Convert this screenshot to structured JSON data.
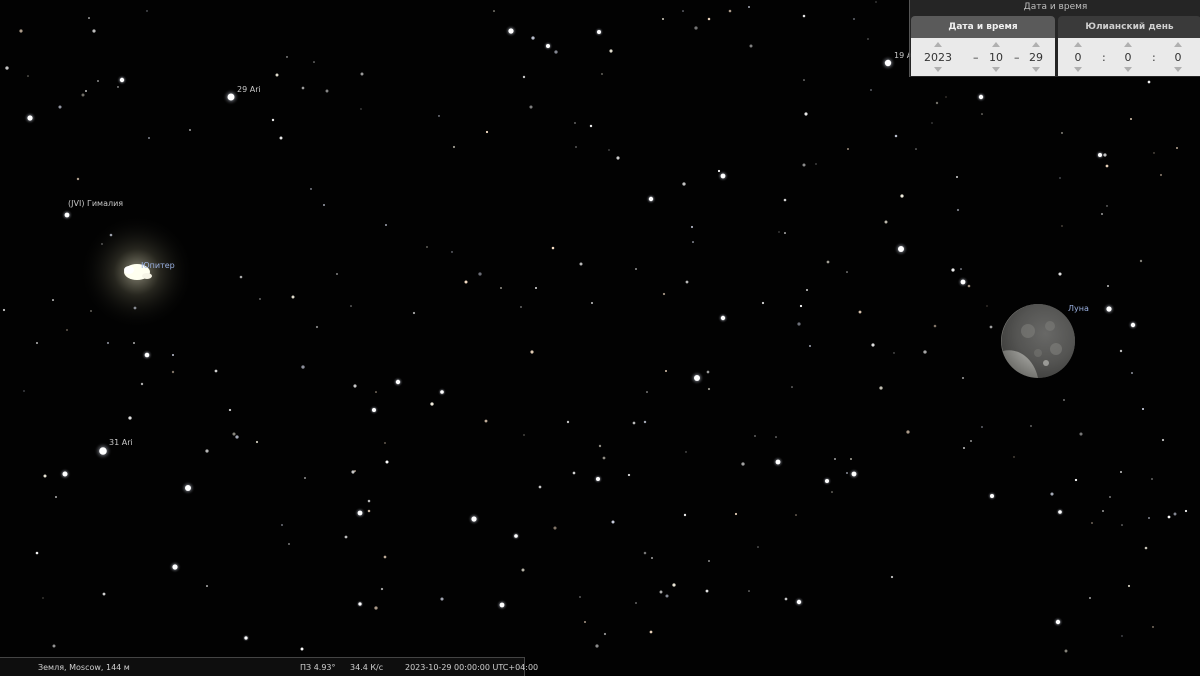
{
  "sky_labels": {
    "ari29": "29 Ari",
    "himalia": "(JVI) Гималия",
    "jupiter": "Юпитер",
    "ari31": "31 Ari",
    "ari19": "19 A",
    "moon": "Луна"
  },
  "datetime_window": {
    "title": "Дата и время",
    "date_tab": {
      "label": "Дата и время",
      "year": "2023",
      "month": "10",
      "day": "29",
      "separator": "–"
    },
    "jd_tab": {
      "label": "Юлианский день",
      "hour": "0",
      "minute": "0",
      "second": "0",
      "separator": ":"
    }
  },
  "statusbar": {
    "location": "Земля, Moscow, 144 м",
    "fov": "ПЗ 4.93°",
    "fps": "34.4 К/с",
    "datetime": "2023-10-29 00:00:00 UTC+04:00"
  },
  "colors": {
    "sky": "#020202",
    "planet_label": "#9ab0e0",
    "panel": "#282828",
    "panel_field": "#eaeaea"
  }
}
